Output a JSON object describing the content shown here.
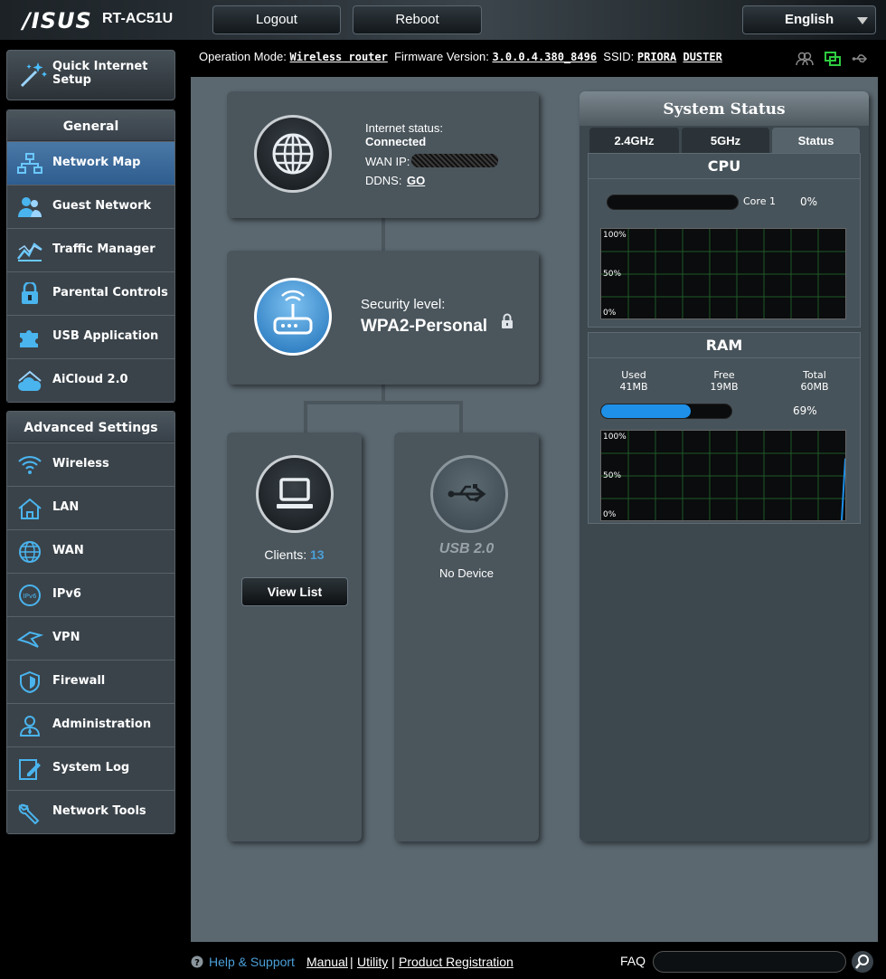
{
  "header": {
    "brand": "/ISUS",
    "model": "RT-AC51U",
    "logout": "Logout",
    "reboot": "Reboot",
    "language": "English"
  },
  "info": {
    "op_mode_label": "Operation Mode:",
    "op_mode_value": "Wireless router",
    "fw_label": "Firmware Version:",
    "fw_value": "3.0.0.4.380_8496",
    "ssid_label": "SSID:",
    "ssid_1": "PRIORA",
    "ssid_2": "DUSTER"
  },
  "sidebar": {
    "qis": "Quick Internet Setup",
    "general_title": "General",
    "general_items": [
      {
        "label": "Network Map",
        "icon": "network-map-icon",
        "active": true
      },
      {
        "label": "Guest Network",
        "icon": "guest-network-icon"
      },
      {
        "label": "Traffic Manager",
        "icon": "traffic-manager-icon"
      },
      {
        "label": "Parental Controls",
        "icon": "parental-controls-icon"
      },
      {
        "label": "USB Application",
        "icon": "puzzle-icon"
      },
      {
        "label": "AiCloud 2.0",
        "icon": "cloud-icon"
      }
    ],
    "advanced_title": "Advanced Settings",
    "advanced_items": [
      {
        "label": "Wireless",
        "icon": "wifi-icon"
      },
      {
        "label": "LAN",
        "icon": "home-icon"
      },
      {
        "label": "WAN",
        "icon": "globe-icon"
      },
      {
        "label": "IPv6",
        "icon": "ipv6-icon"
      },
      {
        "label": "VPN",
        "icon": "vpn-icon"
      },
      {
        "label": "Firewall",
        "icon": "shield-icon"
      },
      {
        "label": "Administration",
        "icon": "admin-icon"
      },
      {
        "label": "System Log",
        "icon": "log-icon"
      },
      {
        "label": "Network Tools",
        "icon": "wrench-icon"
      }
    ]
  },
  "internet": {
    "status_label": "Internet status:",
    "status_value": "Connected",
    "wan_label": "WAN IP:",
    "ddns_label": "DDNS:",
    "ddns_link": "GO"
  },
  "security": {
    "label": "Security level:",
    "value": "WPA2-Personal"
  },
  "clients": {
    "label": "Clients:",
    "count": "13",
    "button": "View List"
  },
  "usb": {
    "title": "USB 2.0",
    "status": "No Device"
  },
  "system_status": {
    "title": "System Status",
    "tabs": [
      "2.4GHz",
      "5GHz",
      "Status"
    ],
    "active_tab": "Status",
    "cpu": {
      "title": "CPU",
      "core_label": "Core 1",
      "core_percent": "0%",
      "core_fraction": 0,
      "graph_labels": [
        "100%",
        "50%",
        "0%"
      ]
    },
    "ram": {
      "title": "RAM",
      "used_label": "Used",
      "used_value": "41MB",
      "free_label": "Free",
      "free_value": "19MB",
      "total_label": "Total",
      "total_value": "60MB",
      "percent": "69%",
      "fraction": 0.69,
      "graph_labels": [
        "100%",
        "50%",
        "0%"
      ]
    }
  },
  "footer": {
    "help": "Help & Support",
    "manual": "Manual",
    "utility": "Utility",
    "registration": "Product Registration",
    "faq": "FAQ"
  },
  "colors": {
    "accent": "#1e90e8",
    "active_menu": "#3a6a9a",
    "clients_count": "#4a9fd8"
  }
}
